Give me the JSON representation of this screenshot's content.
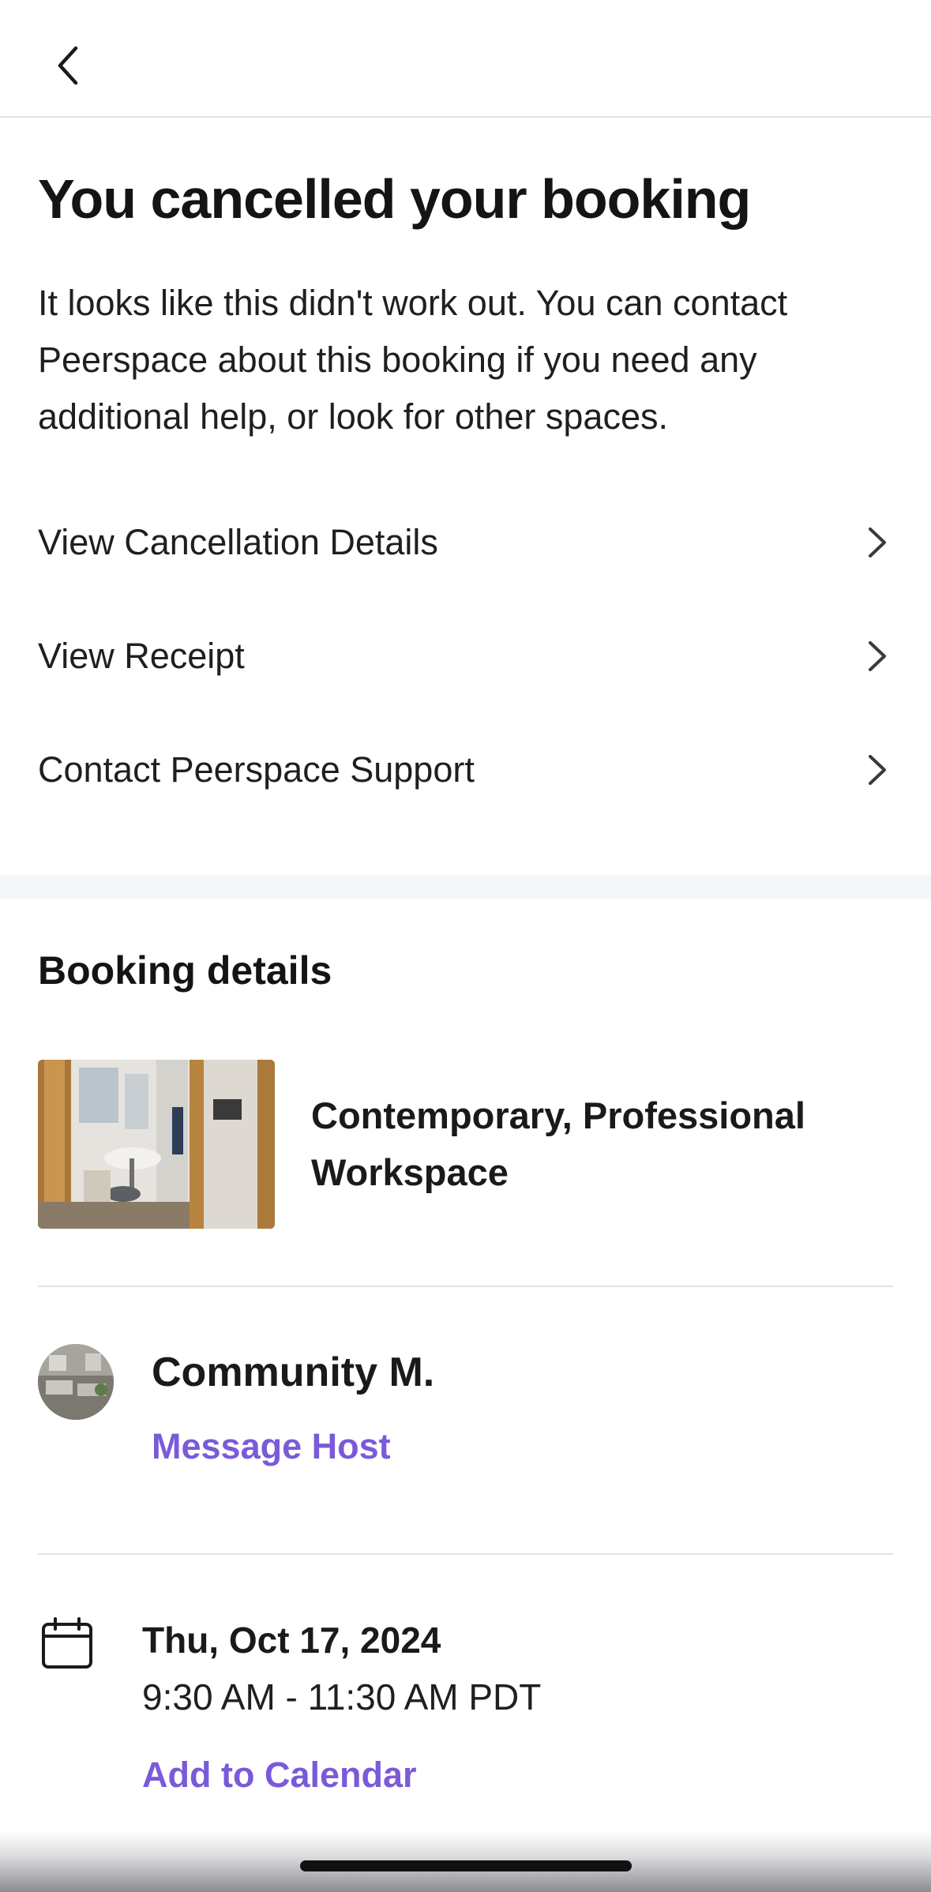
{
  "nav": {
    "back_icon": "chevron-left-icon"
  },
  "header": {
    "title": "You cancelled your booking",
    "intro": "It looks like this didn't work out. You can contact Peerspace about this booking if you need any additional help, or look for other spaces."
  },
  "actions": [
    {
      "label": "View Cancellation Details",
      "icon": "chevron-right-icon"
    },
    {
      "label": "View Receipt",
      "icon": "chevron-right-icon"
    },
    {
      "label": "Contact Peerspace Support",
      "icon": "chevron-right-icon"
    }
  ],
  "booking": {
    "section_title": "Booking details",
    "listing_name": "Contemporary, Professional Workspace",
    "host": {
      "name": "Community M.",
      "message_label": "Message Host"
    },
    "date": "Thu, Oct 17, 2024",
    "time": "9:30 AM - 11:30 AM PDT",
    "add_calendar_label": "Add to Calendar"
  },
  "colors": {
    "accent": "#7a5ad8",
    "text": "#1a1a1a",
    "divider": "#e2e2e2"
  }
}
